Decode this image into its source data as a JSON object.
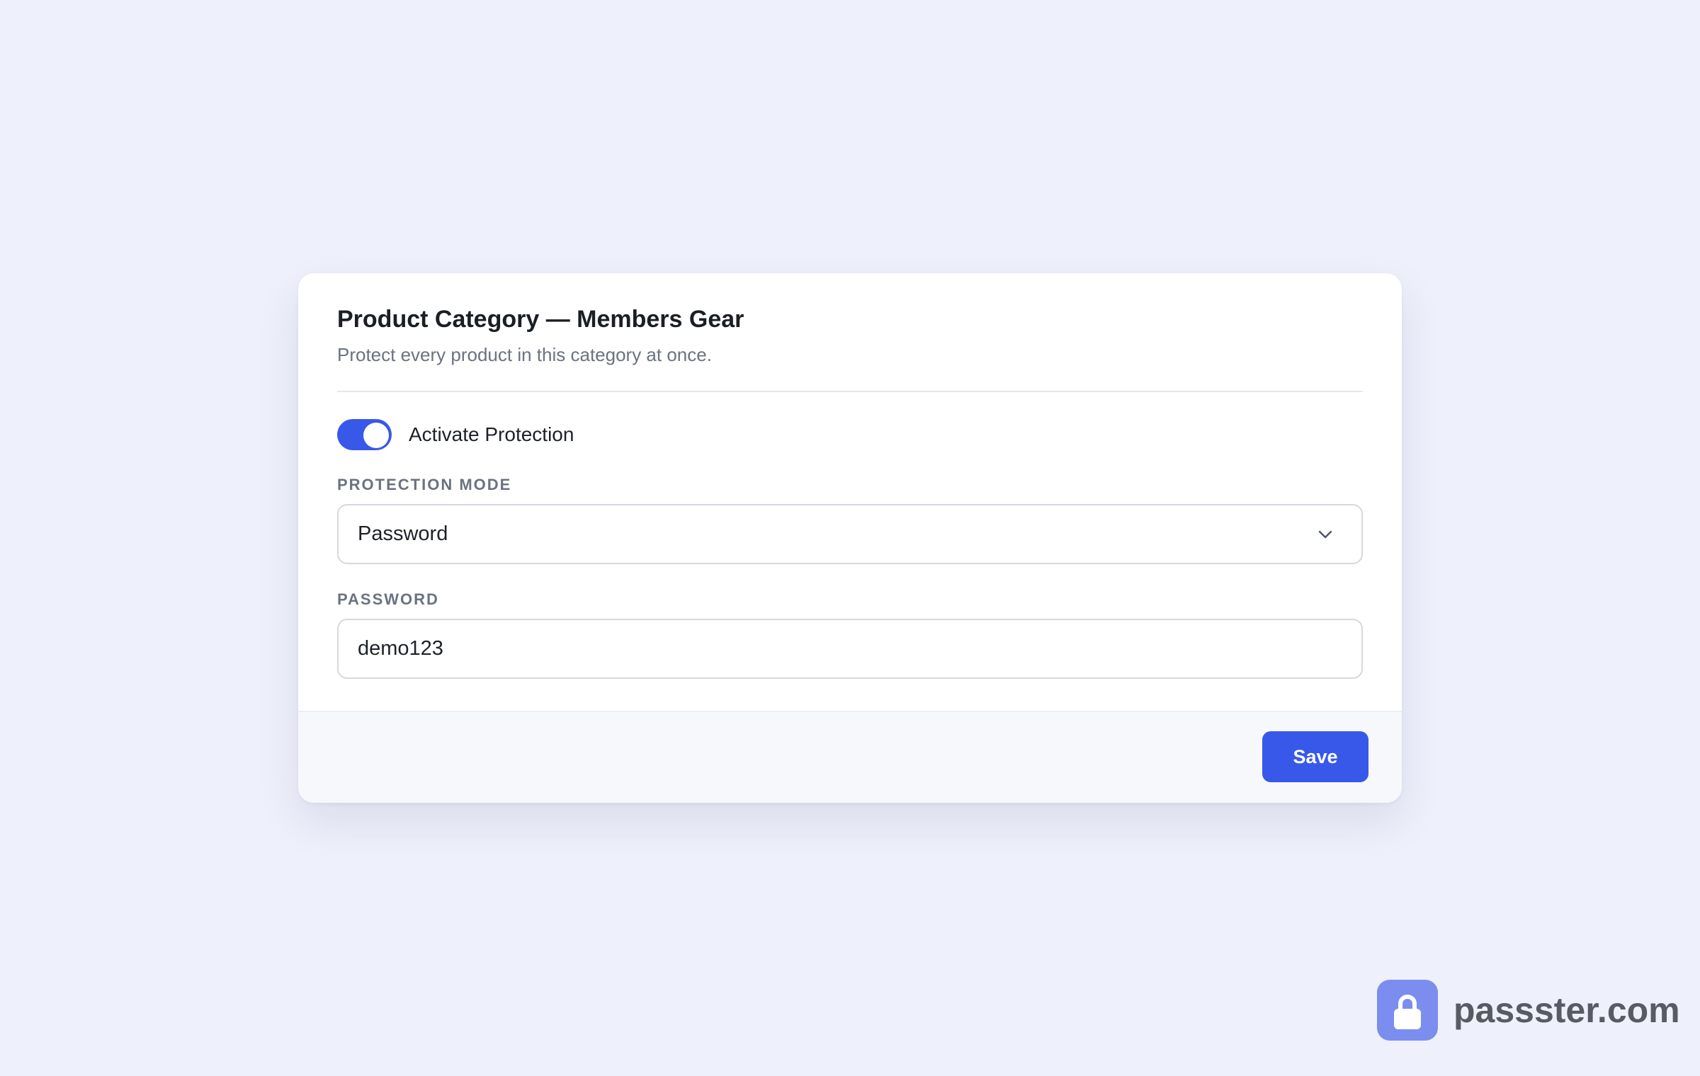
{
  "card": {
    "title": "Product Category — Members Gear",
    "subtitle": "Protect every product in this category at once."
  },
  "protection_toggle": {
    "label": "Activate Protection",
    "state": "on"
  },
  "protection_mode": {
    "label": "PROTECTION MODE",
    "selected": "Password",
    "icon": "chevron-down-icon"
  },
  "password": {
    "label": "PASSWORD",
    "value": "demo123"
  },
  "footer": {
    "save_label": "Save"
  },
  "brand": {
    "icon": "lock-icon",
    "name": "passster.com"
  },
  "colors": {
    "page_background": "#eef0fb",
    "accent": "#3858e9",
    "brand_badge": "#7b8eef",
    "muted_text": "#6b7280"
  }
}
